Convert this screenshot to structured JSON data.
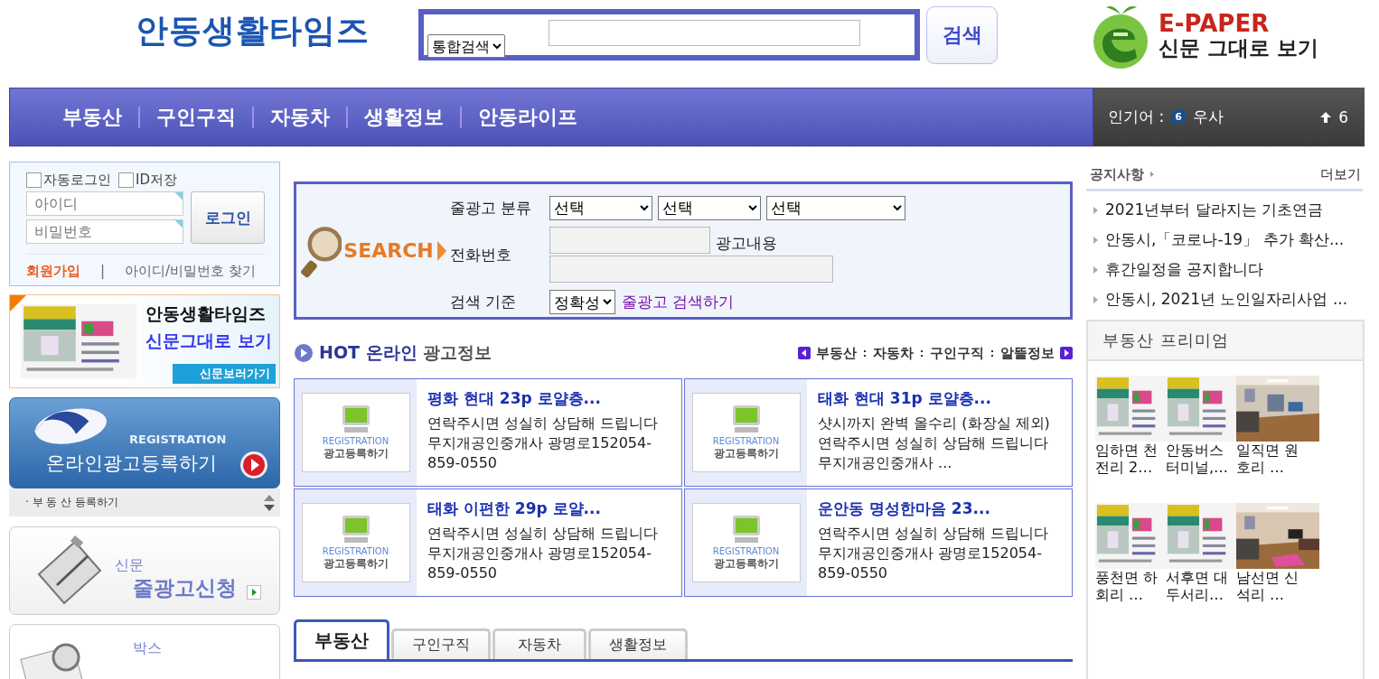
{
  "header": {
    "logo": "안동생활타임즈",
    "search_scope": "통합검색",
    "search_button": "검색",
    "epaper_title": "E-PAPER",
    "epaper_subtitle": "신문 그대로 보기"
  },
  "nav": {
    "items": [
      "부동산",
      "구인구직",
      "자동차",
      "생활정보",
      "안동라이프"
    ],
    "popular_label": "인기어 :",
    "popular_rank": "6",
    "popular_keyword": "우사",
    "popular_change": "6"
  },
  "login": {
    "options": [
      {
        "label": "자동로그인",
        "checked": false
      },
      {
        "label": "ID저장",
        "checked": false
      }
    ],
    "id_placeholder": "아이디",
    "password_placeholder": "비밀번호",
    "button": "로그인",
    "join": "회원가입",
    "separator": "|",
    "find": "아이디/비밀번호 찾기"
  },
  "left_banners": {
    "paper_title": "안동생활타임즈",
    "paper_subtitle": "신문그대로 보기",
    "paper_button": "신문보러가기",
    "registration_en": "REGISTRATION",
    "registration": "온라인광고등록하기",
    "ticker": "· 부 동 산 등록하기",
    "apply_small": "신문",
    "apply": "줄광고신청",
    "box_small": "박스"
  },
  "class_search": {
    "logo": "SEARCH",
    "category_label": "줄광고 분류",
    "selects": [
      "선택",
      "선택",
      "선택"
    ],
    "phone_label": "전화번호",
    "content_label": "광고내용",
    "order_label": "검색 기준",
    "order": "정확성",
    "submit": "줄광고 검색하기"
  },
  "hot_ads": {
    "title_strong": "HOT 온라인",
    "title": "광고정보",
    "categories": [
      "부동산",
      "자동차",
      "구인구직",
      "알뜰정보"
    ],
    "ads": [
      {
        "thumb_en": "REGISTRATION",
        "thumb": "광고등록하기",
        "title": "평화 현대 23p 로얄층...",
        "lines": [
          "연락주시면 성실히 상담해 드립니다",
          "무지개공인중개사 광명로152054-",
          "859-0550"
        ]
      },
      {
        "thumb_en": "REGISTRATION",
        "thumb": "광고등록하기",
        "title": "태화 현대 31p 로얄층...",
        "lines": [
          "샷시까지 완벽 올수리 (화장실 제외)",
          "연락주시면 성실히 상담해 드립니다",
          "무지개공인중개사 ..."
        ]
      },
      {
        "thumb_en": "REGISTRATION",
        "thumb": "광고등록하기",
        "title": "태화 이편한 29p 로얄...",
        "lines": [
          "연락주시면 성실히 상담해 드립니다",
          "무지개공인중개사 광명로152054-",
          "859-0550"
        ]
      },
      {
        "thumb_en": "REGISTRATION",
        "thumb": "광고등록하기",
        "title": "운안동 명성한마음 23...",
        "lines": [
          "연락주시면 성실히 상담해 드립니다",
          "무지개공인중개사 광명로152054-",
          "859-0550"
        ]
      }
    ]
  },
  "tabs": {
    "items": [
      {
        "label": "부동산",
        "selected": true
      },
      {
        "label": "구인구직",
        "selected": false
      },
      {
        "label": "자동차",
        "selected": false
      },
      {
        "label": "생활정보",
        "selected": false
      }
    ]
  },
  "notices": {
    "title": "공지사항",
    "more": "더보기",
    "items": [
      "2021년부터 달라지는 기초연금",
      "안동시,「코로나-19」 추가 확산...",
      "휴간일정을 공지합니다",
      "안동시, 2021년 노인일자리사업 ..."
    ]
  },
  "premium": {
    "title": "부동산 프리미엄",
    "items": [
      {
        "caption": "임하면 천전리 2…"
      },
      {
        "caption": "안동버스터미널,…"
      },
      {
        "caption": "일직면 원호리 …"
      },
      {
        "caption": "풍천면 하회리 …"
      },
      {
        "caption": "서후면 대두서리…"
      },
      {
        "caption": "남선면 신석리 …"
      }
    ]
  }
}
